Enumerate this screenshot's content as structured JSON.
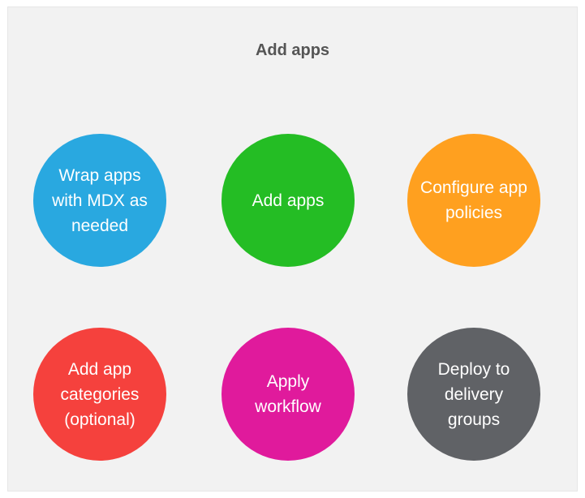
{
  "title": "Add apps",
  "steps": [
    {
      "label": "Wrap apps\nwith MDX as\nneeded",
      "color": "#29a8e0"
    },
    {
      "label": "Add apps",
      "color": "#24bd24"
    },
    {
      "label": "Configure app\npolicies",
      "color": "#ffa01f"
    },
    {
      "label": "Add app\ncategories\n(optional)",
      "color": "#f5413d"
    },
    {
      "label": "Apply\nworkflow",
      "color": "#e01a9c"
    },
    {
      "label": "Deploy to\ndelivery\ngroups",
      "color": "#606266"
    }
  ]
}
